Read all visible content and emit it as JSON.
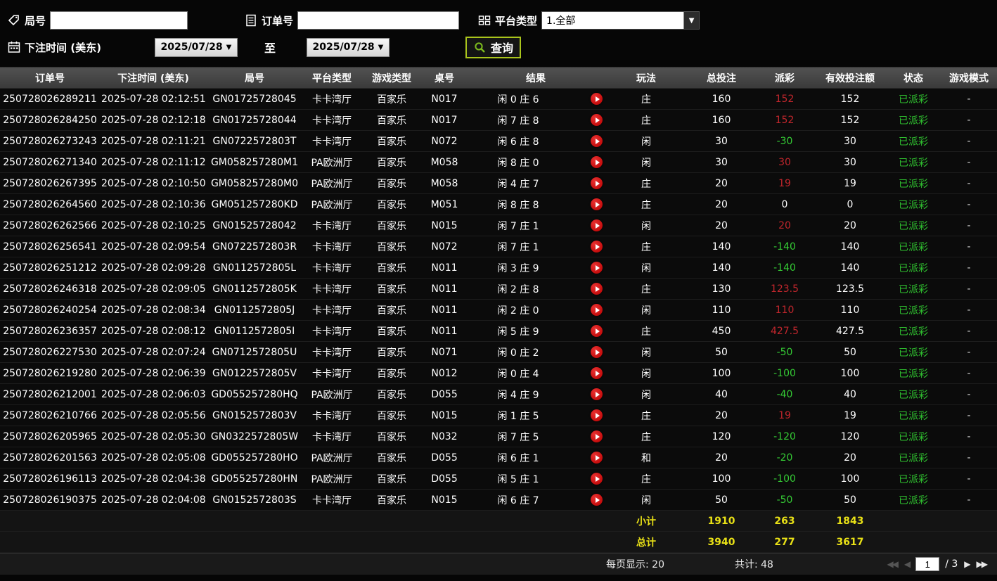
{
  "filters": {
    "game_id_label": "局号",
    "order_id_label": "订单号",
    "platform_label": "平台类型",
    "platform_value": "1.全部",
    "bet_time_label": "下注时间 (美东)",
    "date_from": "2025/07/28",
    "date_to": "2025/07/28",
    "to_label": "至",
    "query_label": "查询",
    "dropdown_arrow": "▼"
  },
  "colors": {
    "payout_positive": "#c0262c",
    "payout_negative": "#35cc35",
    "status_paid": "#2fbf2f",
    "summary_yellow": "#e9e116",
    "query_border": "#a9c41c",
    "play_icon_red": "#c00000"
  },
  "table": {
    "headers": [
      "订单号",
      "下注时间 (美东)",
      "局号",
      "平台类型",
      "游戏类型",
      "桌号",
      "结果",
      "玩法",
      "总投注",
      "派彩",
      "有效投注额",
      "状态",
      "游戏模式"
    ],
    "rows": [
      {
        "order_id": "250728026289211",
        "bet_time": "2025-07-28 02:12:51",
        "game_id": "GN01725728045",
        "platform": "卡卡湾厅",
        "game_type": "百家乐",
        "table_no": "N017",
        "result": "闲 0 庄 6",
        "play": "庄",
        "total_bet": "160",
        "payout": "152",
        "valid_bet": "152",
        "status": "已派彩",
        "mode": "-"
      },
      {
        "order_id": "250728026284250",
        "bet_time": "2025-07-28 02:12:18",
        "game_id": "GN01725728044",
        "platform": "卡卡湾厅",
        "game_type": "百家乐",
        "table_no": "N017",
        "result": "闲 7 庄 8",
        "play": "庄",
        "total_bet": "160",
        "payout": "152",
        "valid_bet": "152",
        "status": "已派彩",
        "mode": "-"
      },
      {
        "order_id": "250728026273243",
        "bet_time": "2025-07-28 02:11:21",
        "game_id": "GN0722572803T",
        "platform": "卡卡湾厅",
        "game_type": "百家乐",
        "table_no": "N072",
        "result": "闲 6 庄 8",
        "play": "闲",
        "total_bet": "30",
        "payout": "-30",
        "valid_bet": "30",
        "status": "已派彩",
        "mode": "-"
      },
      {
        "order_id": "250728026271340",
        "bet_time": "2025-07-28 02:11:12",
        "game_id": "GM058257280M1",
        "platform": "PA欧洲厅",
        "game_type": "百家乐",
        "table_no": "M058",
        "result": "闲 8 庄 0",
        "play": "闲",
        "total_bet": "30",
        "payout": "30",
        "valid_bet": "30",
        "status": "已派彩",
        "mode": "-"
      },
      {
        "order_id": "250728026267395",
        "bet_time": "2025-07-28 02:10:50",
        "game_id": "GM058257280M0",
        "platform": "PA欧洲厅",
        "game_type": "百家乐",
        "table_no": "M058",
        "result": "闲 4 庄 7",
        "play": "庄",
        "total_bet": "20",
        "payout": "19",
        "valid_bet": "19",
        "status": "已派彩",
        "mode": "-"
      },
      {
        "order_id": "250728026264560",
        "bet_time": "2025-07-28 02:10:36",
        "game_id": "GM051257280KD",
        "platform": "PA欧洲厅",
        "game_type": "百家乐",
        "table_no": "M051",
        "result": "闲 8 庄 8",
        "play": "庄",
        "total_bet": "20",
        "payout": "0",
        "valid_bet": "0",
        "status": "已派彩",
        "mode": "-"
      },
      {
        "order_id": "250728026262566",
        "bet_time": "2025-07-28 02:10:25",
        "game_id": "GN01525728042",
        "platform": "卡卡湾厅",
        "game_type": "百家乐",
        "table_no": "N015",
        "result": "闲 7 庄 1",
        "play": "闲",
        "total_bet": "20",
        "payout": "20",
        "valid_bet": "20",
        "status": "已派彩",
        "mode": "-"
      },
      {
        "order_id": "250728026256541",
        "bet_time": "2025-07-28 02:09:54",
        "game_id": "GN0722572803R",
        "platform": "卡卡湾厅",
        "game_type": "百家乐",
        "table_no": "N072",
        "result": "闲 7 庄 1",
        "play": "庄",
        "total_bet": "140",
        "payout": "-140",
        "valid_bet": "140",
        "status": "已派彩",
        "mode": "-"
      },
      {
        "order_id": "250728026251212",
        "bet_time": "2025-07-28 02:09:28",
        "game_id": "GN0112572805L",
        "platform": "卡卡湾厅",
        "game_type": "百家乐",
        "table_no": "N011",
        "result": "闲 3 庄 9",
        "play": "闲",
        "total_bet": "140",
        "payout": "-140",
        "valid_bet": "140",
        "status": "已派彩",
        "mode": "-"
      },
      {
        "order_id": "250728026246318",
        "bet_time": "2025-07-28 02:09:05",
        "game_id": "GN0112572805K",
        "platform": "卡卡湾厅",
        "game_type": "百家乐",
        "table_no": "N011",
        "result": "闲 2 庄 8",
        "play": "庄",
        "total_bet": "130",
        "payout": "123.5",
        "valid_bet": "123.5",
        "status": "已派彩",
        "mode": "-"
      },
      {
        "order_id": "250728026240254",
        "bet_time": "2025-07-28 02:08:34",
        "game_id": "GN0112572805J",
        "platform": "卡卡湾厅",
        "game_type": "百家乐",
        "table_no": "N011",
        "result": "闲 2 庄 0",
        "play": "闲",
        "total_bet": "110",
        "payout": "110",
        "valid_bet": "110",
        "status": "已派彩",
        "mode": "-"
      },
      {
        "order_id": "250728026236357",
        "bet_time": "2025-07-28 02:08:12",
        "game_id": "GN0112572805I",
        "platform": "卡卡湾厅",
        "game_type": "百家乐",
        "table_no": "N011",
        "result": "闲 5 庄 9",
        "play": "庄",
        "total_bet": "450",
        "payout": "427.5",
        "valid_bet": "427.5",
        "status": "已派彩",
        "mode": "-"
      },
      {
        "order_id": "250728026227530",
        "bet_time": "2025-07-28 02:07:24",
        "game_id": "GN0712572805U",
        "platform": "卡卡湾厅",
        "game_type": "百家乐",
        "table_no": "N071",
        "result": "闲 0 庄 2",
        "play": "闲",
        "total_bet": "50",
        "payout": "-50",
        "valid_bet": "50",
        "status": "已派彩",
        "mode": "-"
      },
      {
        "order_id": "250728026219280",
        "bet_time": "2025-07-28 02:06:39",
        "game_id": "GN0122572805V",
        "platform": "卡卡湾厅",
        "game_type": "百家乐",
        "table_no": "N012",
        "result": "闲 0 庄 4",
        "play": "闲",
        "total_bet": "100",
        "payout": "-100",
        "valid_bet": "100",
        "status": "已派彩",
        "mode": "-"
      },
      {
        "order_id": "250728026212001",
        "bet_time": "2025-07-28 02:06:03",
        "game_id": "GD055257280HQ",
        "platform": "PA欧洲厅",
        "game_type": "百家乐",
        "table_no": "D055",
        "result": "闲 4 庄 9",
        "play": "闲",
        "total_bet": "40",
        "payout": "-40",
        "valid_bet": "40",
        "status": "已派彩",
        "mode": "-"
      },
      {
        "order_id": "250728026210766",
        "bet_time": "2025-07-28 02:05:56",
        "game_id": "GN0152572803V",
        "platform": "卡卡湾厅",
        "game_type": "百家乐",
        "table_no": "N015",
        "result": "闲 1 庄 5",
        "play": "庄",
        "total_bet": "20",
        "payout": "19",
        "valid_bet": "19",
        "status": "已派彩",
        "mode": "-"
      },
      {
        "order_id": "250728026205965",
        "bet_time": "2025-07-28 02:05:30",
        "game_id": "GN0322572805W",
        "platform": "卡卡湾厅",
        "game_type": "百家乐",
        "table_no": "N032",
        "result": "闲 7 庄 5",
        "play": "庄",
        "total_bet": "120",
        "payout": "-120",
        "valid_bet": "120",
        "status": "已派彩",
        "mode": "-"
      },
      {
        "order_id": "250728026201563",
        "bet_time": "2025-07-28 02:05:08",
        "game_id": "GD055257280HO",
        "platform": "PA欧洲厅",
        "game_type": "百家乐",
        "table_no": "D055",
        "result": "闲 6 庄 1",
        "play": "和",
        "total_bet": "20",
        "payout": "-20",
        "valid_bet": "20",
        "status": "已派彩",
        "mode": "-"
      },
      {
        "order_id": "250728026196113",
        "bet_time": "2025-07-28 02:04:38",
        "game_id": "GD055257280HN",
        "platform": "PA欧洲厅",
        "game_type": "百家乐",
        "table_no": "D055",
        "result": "闲 5 庄 1",
        "play": "庄",
        "total_bet": "100",
        "payout": "-100",
        "valid_bet": "100",
        "status": "已派彩",
        "mode": "-"
      },
      {
        "order_id": "250728026190375",
        "bet_time": "2025-07-28 02:04:08",
        "game_id": "GN0152572803S",
        "platform": "卡卡湾厅",
        "game_type": "百家乐",
        "table_no": "N015",
        "result": "闲 6 庄 7",
        "play": "闲",
        "total_bet": "50",
        "payout": "-50",
        "valid_bet": "50",
        "status": "已派彩",
        "mode": "-"
      }
    ],
    "subtotal": {
      "label": "小计",
      "total_bet": "1910",
      "payout": "263",
      "valid_bet": "1843"
    },
    "grand_total": {
      "label": "总计",
      "total_bet": "3940",
      "payout": "277",
      "valid_bet": "3617"
    }
  },
  "footer": {
    "per_page_label": "每页显示: 20",
    "total_label": "共计: 48",
    "page_value": "1",
    "page_total_label": "/ 3",
    "first_icon": "◀◀",
    "prev_icon": "◀",
    "next_icon": "▶",
    "last_icon": "▶▶"
  }
}
